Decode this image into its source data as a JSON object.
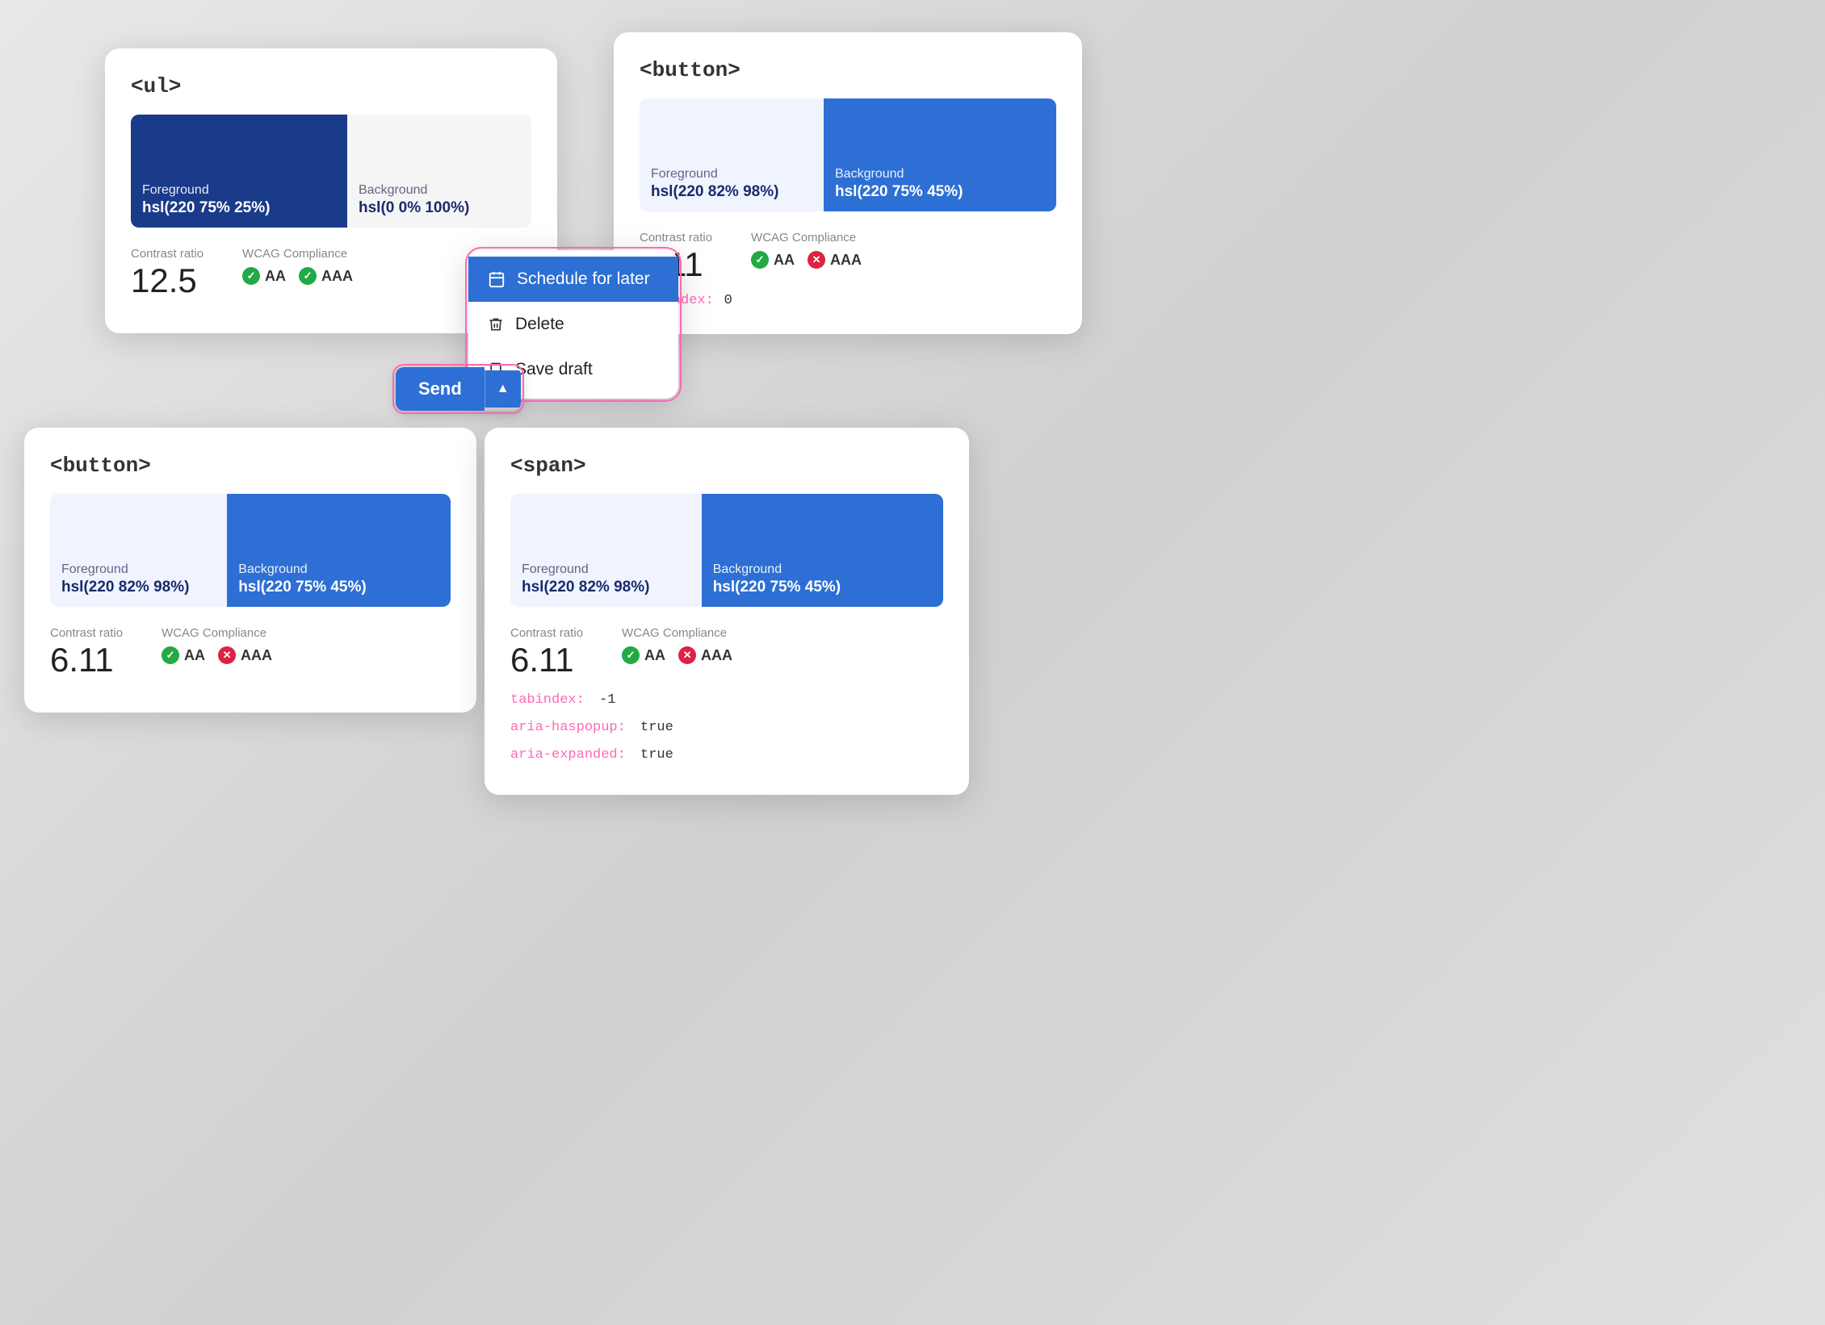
{
  "cards": {
    "top_left": {
      "title": "<ul>",
      "foreground_label": "Foreground",
      "foreground_value": "hsl(220 75% 25%)",
      "background_label": "Background",
      "background_value": "hsl(0 0% 100%)",
      "fg_color": "#1a3a8a",
      "bg_color": "#ffffff",
      "contrast_label": "Contrast ratio",
      "contrast_value": "12.5",
      "wcag_label": "WCAG Compliance",
      "aa_label": "AA",
      "aaa_label": "AAA",
      "aa_pass": true,
      "aaa_pass": true
    },
    "top_right": {
      "title": "<button>",
      "foreground_label": "Foreground",
      "foreground_value": "hsl(220 82% 98%)",
      "background_label": "Background",
      "background_value": "hsl(220 75% 45%)",
      "fg_color": "#f0f4ff",
      "bg_color": "#2d6fd4",
      "contrast_label": "Contrast ratio",
      "contrast_value": "6.11",
      "wcag_label": "WCAG Compliance",
      "aa_label": "AA",
      "aaa_label": "AAA",
      "aa_pass": true,
      "aaa_pass": false,
      "tabindex_label": "tabindex:",
      "tabindex_value": "0"
    },
    "bottom_left": {
      "title": "<button>",
      "foreground_label": "Foreground",
      "foreground_value": "hsl(220 82% 98%)",
      "background_label": "Background",
      "background_value": "hsl(220 75% 45%)",
      "fg_color": "#f0f4ff",
      "bg_color": "#2d6fd4",
      "contrast_label": "Contrast ratio",
      "contrast_value": "6.11",
      "wcag_label": "WCAG Compliance",
      "aa_label": "AA",
      "aaa_label": "AAA",
      "aa_pass": true,
      "aaa_pass": false
    },
    "bottom_right": {
      "title": "<span>",
      "foreground_label": "Foreground",
      "foreground_value": "hsl(220 82% 98%)",
      "background_label": "Background",
      "background_value": "hsl(220 75% 45%)",
      "fg_color": "#f0f4ff",
      "bg_color": "#2d6fd4",
      "contrast_label": "Contrast ratio",
      "contrast_value": "6.11",
      "wcag_label": "WCAG Compliance",
      "aa_label": "AA",
      "aaa_label": "AAA",
      "aa_pass": true,
      "aaa_pass": false,
      "tabindex_label": "tabindex:",
      "tabindex_value": "-1",
      "aria_haspopup_label": "aria-haspopup:",
      "aria_haspopup_value": "true",
      "aria_expanded_label": "aria-expanded:",
      "aria_expanded_value": "true"
    }
  },
  "dropdown": {
    "items": [
      {
        "label": "Schedule for later",
        "icon": "calendar"
      },
      {
        "label": "Delete",
        "icon": "trash"
      },
      {
        "label": "Save draft",
        "icon": "bookmark"
      }
    ]
  },
  "send_button": {
    "label": "Send",
    "chevron": "▲"
  }
}
